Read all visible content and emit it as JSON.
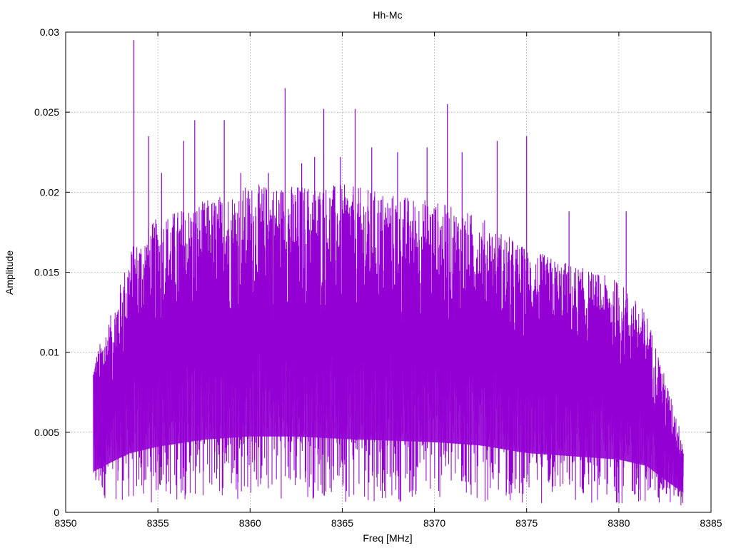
{
  "chart_data": {
    "type": "line",
    "title": "Hh-Mc",
    "xlabel": "Freq [MHz]",
    "ylabel": "Amplitude",
    "xlim": [
      8350,
      8385
    ],
    "ylim": [
      0,
      0.03
    ],
    "x_ticks": [
      8350,
      8355,
      8360,
      8365,
      8370,
      8375,
      8380,
      8385
    ],
    "y_ticks": [
      0,
      0.005,
      0.01,
      0.015,
      0.02,
      0.025,
      0.03
    ],
    "x_tick_labels": [
      "8350",
      "8355",
      "8360",
      "8365",
      "8370",
      "8375",
      "8380",
      "8385"
    ],
    "y_tick_labels": [
      "0",
      "0.005",
      "0.01",
      "0.015",
      "0.02",
      "0.025",
      "0.03"
    ],
    "grid": true,
    "series": [
      {
        "color": "#9400d3",
        "x_range": [
          8351.5,
          8383.5
        ],
        "envelope": {
          "x": [
            8351.5,
            8352.5,
            8353.5,
            8355,
            8357.5,
            8360,
            8362.5,
            8365,
            8367.5,
            8370,
            8372.5,
            8375,
            8377.5,
            8380,
            8381.5,
            8382.5,
            8383.5
          ],
          "upper": [
            0.0095,
            0.0125,
            0.0165,
            0.0185,
            0.0195,
            0.0205,
            0.0205,
            0.0205,
            0.02,
            0.0195,
            0.0185,
            0.0165,
            0.0155,
            0.0145,
            0.0125,
            0.0085,
            0.0045
          ],
          "lower": [
            0.0008,
            0.0008,
            0.0005,
            0.0005,
            0.0008,
            0.0008,
            0.0008,
            0.0006,
            0.0006,
            0.0006,
            0.0006,
            0.0005,
            0.0005,
            0.0005,
            0.0005,
            0.0004,
            0.0004
          ]
        },
        "peaks": [
          {
            "x": 8353.7,
            "y": 0.0295
          },
          {
            "x": 8354.5,
            "y": 0.0235
          },
          {
            "x": 8355.2,
            "y": 0.0212
          },
          {
            "x": 8356.4,
            "y": 0.0232
          },
          {
            "x": 8357.0,
            "y": 0.0245
          },
          {
            "x": 8358.6,
            "y": 0.0245
          },
          {
            "x": 8359.5,
            "y": 0.0212
          },
          {
            "x": 8361.0,
            "y": 0.0212
          },
          {
            "x": 8361.9,
            "y": 0.0265
          },
          {
            "x": 8362.8,
            "y": 0.0218
          },
          {
            "x": 8363.5,
            "y": 0.0222
          },
          {
            "x": 8364.0,
            "y": 0.0252
          },
          {
            "x": 8364.9,
            "y": 0.0222
          },
          {
            "x": 8365.7,
            "y": 0.0252
          },
          {
            "x": 8366.6,
            "y": 0.0228
          },
          {
            "x": 8368.0,
            "y": 0.0225
          },
          {
            "x": 8369.6,
            "y": 0.0228
          },
          {
            "x": 8370.7,
            "y": 0.0255
          },
          {
            "x": 8371.5,
            "y": 0.0225
          },
          {
            "x": 8373.4,
            "y": 0.0232
          },
          {
            "x": 8375.0,
            "y": 0.0235
          },
          {
            "x": 8377.3,
            "y": 0.0188
          },
          {
            "x": 8380.4,
            "y": 0.0188
          }
        ]
      }
    ]
  }
}
